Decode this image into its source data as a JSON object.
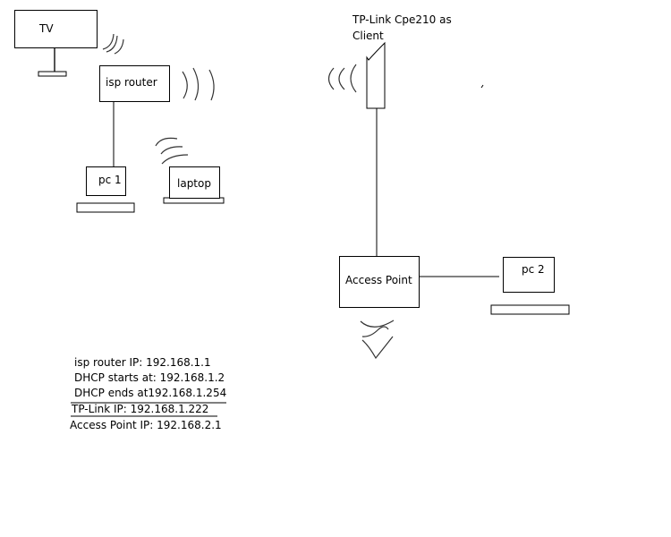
{
  "diagram": {
    "nodes": {
      "tv": {
        "label": "TV"
      },
      "isp_router": {
        "label": "isp router"
      },
      "pc1": {
        "label": "pc 1"
      },
      "laptop": {
        "label": "laptop"
      },
      "tplink": {
        "label_line1": "TP-Link Cpe210 as",
        "label_line2": "Client"
      },
      "access_point": {
        "label": "Access Point"
      },
      "pc2": {
        "label": "pc 2"
      }
    },
    "notes": [
      "isp router IP: 192.168.1.1",
      "DHCP starts at: 192.168.1.2",
      "DHCP ends at192.168.1.254",
      "TP-Link IP: 192.168.1.222",
      "Access Point IP: 192.168.2.1"
    ]
  }
}
